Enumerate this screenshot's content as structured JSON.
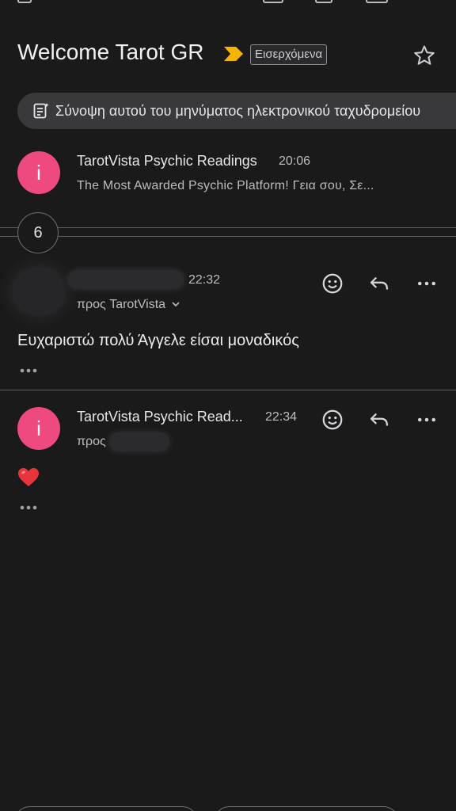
{
  "header": {
    "subject": "Welcome Tarot GR",
    "label": "Εισερχόμενα",
    "important_color": "#f5b400"
  },
  "summary": {
    "text": "Σύνοψη αυτού του μηνύματος ηλεκτρονικού ταχυδρομείου"
  },
  "messages": [
    {
      "avatar_letter": "i",
      "sender": "TarotVista Psychic Readings",
      "time": "20:06",
      "snippet": "The Most Awarded Psychic Platform! Γεια σου, Σε..."
    },
    {
      "sender": "",
      "time": "22:32",
      "recipient": "προς TarotVista",
      "body": "Ευχαριστώ πολύ Άγγελε είσαι μοναδικός"
    },
    {
      "avatar_letter": "i",
      "sender": "TarotVista Psychic Read...",
      "time": "22:34",
      "recipient": "προς",
      "body_icon": "heart-emoji"
    }
  ],
  "collapsed": {
    "count": "6"
  },
  "colors": {
    "avatar": "#ee4a7f",
    "background": "#1b1a1b"
  }
}
